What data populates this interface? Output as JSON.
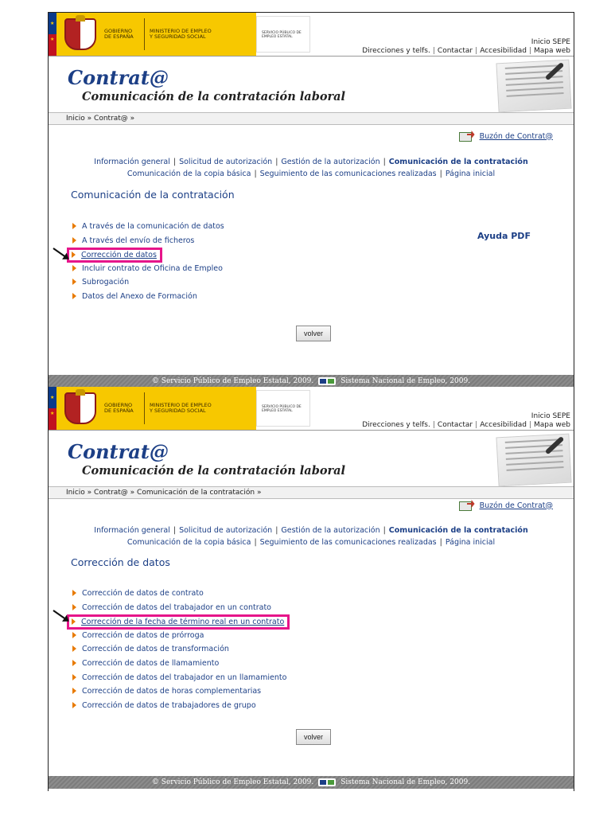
{
  "header": {
    "gov_label": "Gobierno de España",
    "ministry_label": "Ministerio de Empleo y Seguridad Social",
    "sepe_label": "Servicio Público de Empleo Estatal",
    "inicio_sepe": "Inicio SEPE",
    "top_links": [
      "Direcciones y telfs.",
      "Contactar",
      "Accesibilidad",
      "Mapa web"
    ]
  },
  "brand": {
    "title": "Contrat@",
    "subtitle": "Comunicación de la contratación laboral"
  },
  "mailbox_label": "Buzón de Contrat@",
  "nav": {
    "row1": [
      "Información general",
      "Solicitud de autorización",
      "Gestión de la autorización",
      "Comunicación de la contratación"
    ],
    "row2": [
      "Comunicación de la copia básica",
      "Seguimiento de las comunicaciones realizadas",
      "Página inicial"
    ]
  },
  "screen1": {
    "breadcrumb": "Inicio » Contrat@ »",
    "section_title": "Comunicación de la contratación",
    "items": [
      "A través de la comunicación de datos",
      "A través del envío de ficheros",
      "Corrección de datos",
      "Incluir contrato de Oficina de Empleo",
      "Subrogación",
      "Datos del Anexo de Formación"
    ],
    "help_label": "Ayuda PDF",
    "back_label": "volver"
  },
  "screen2": {
    "breadcrumb": "Inicio » Contrat@ » Comunicación de la contratación »",
    "section_title": "Corrección de datos",
    "items": [
      "Corrección de datos de contrato",
      "Corrección de datos del trabajador en un contrato",
      "Corrección de la fecha de término real en un contrato",
      "Corrección de datos de prórroga",
      "Corrección de datos de transformación",
      "Corrección de datos de llamamiento",
      "Corrección de datos del trabajador en un llamamiento",
      "Corrección de datos de horas complementarias",
      "Corrección de datos de trabajadores de grupo"
    ],
    "back_label": "volver"
  },
  "footer": {
    "left": "© Servicio Público de Empleo Estatal, 2009.",
    "right": "Sistema Nacional de Empleo, 2009."
  },
  "colors": {
    "link": "#1c3f86",
    "highlight": "#e6158a",
    "bullet": "#e87a00",
    "gov_yellow": "#f7c800"
  }
}
